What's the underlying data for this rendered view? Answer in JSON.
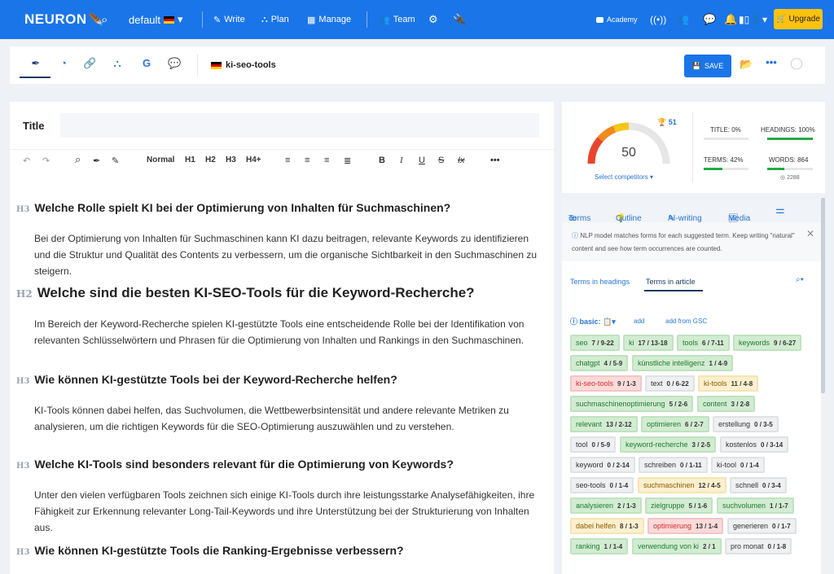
{
  "nav": {
    "logo": "NEURON",
    "project": "default",
    "write": "Write",
    "plan": "Plan",
    "manage": "Manage",
    "team": "Team",
    "academy": "Academy",
    "upgrade": "Upgrade"
  },
  "toolbar": {
    "doc_name": "ki-seo-tools",
    "save": "SAVE"
  },
  "editor": {
    "title_label": "Title",
    "title_value": "",
    "format": {
      "style": "Normal",
      "h1": "H1",
      "h2": "H2",
      "h3": "H3",
      "h4": "H4+",
      "bold": "B",
      "italic": "I",
      "underline": "U",
      "strike": "S",
      "clear": "Ix",
      "more": "•••"
    },
    "blocks": [
      {
        "level": "H3",
        "text": "Welche Rolle spielt KI bei der Optimierung von Inhalten für Suchmaschinen?"
      },
      {
        "text": "Bei der Optimierung von Inhalten für Suchmaschinen kann KI dazu beitragen, relevante Keywords zu identifizieren und die Struktur und Qualität des Contents zu verbessern, um die organische Sichtbarkeit in den Suchmaschinen zu steigern."
      },
      {
        "level": "H2",
        "text": "Welche sind die besten KI-SEO-Tools für die Keyword-Recherche?"
      },
      {
        "text": "Im Bereich der Keyword-Recherche spielen KI-gestützte Tools eine entscheidende Rolle bei der Identifikation von relevanten Schlüsselwörtern und Phrasen für die Optimierung von Inhalten und Rankings in den Suchmaschinen."
      },
      {
        "level": "H3",
        "text": "Wie können KI-gestützte Tools bei der Keyword-Recherche helfen?"
      },
      {
        "text": "KI-Tools können dabei helfen, das Suchvolumen, die Wettbewerbsintensität und andere relevante Metriken zu analysieren, um die richtigen Keywords für die SEO-Optimierung auszuwählen und zu verstehen."
      },
      {
        "level": "H3",
        "text": "Welche KI-Tools sind besonders relevant für die Optimierung von Keywords?"
      },
      {
        "text": "Unter den vielen verfügbaren Tools zeichnen sich einige KI-Tools durch ihre leistungsstarke Analysefähigkeiten, ihre Fähigkeit zur Erkennung relevanter Long-Tail-Keywords und ihre Unterstützung bei der Strukturierung von Inhalten aus."
      },
      {
        "level": "H3",
        "text": "Wie können KI-gestützte Tools die Ranking-Ergebnisse verbessern?"
      }
    ]
  },
  "score": {
    "value": "50",
    "value_fraction": 0.5,
    "competitor_score": "51",
    "select_competitors": "Select competitors ▾",
    "title_stat": "TITLE: 0%",
    "title_fraction": 0,
    "headings_stat": "HEADINGS: 100%",
    "headings_fraction": 1.0,
    "terms_stat": "TERMS: 42%",
    "terms_fraction": 0.42,
    "words_stat": "WORDS: 864",
    "words_fraction": 0.38,
    "words_target": "2288"
  },
  "side": {
    "tabs": [
      "Terms",
      "Outline",
      "AI-writing",
      "Media"
    ],
    "info": "NLP model matches forms for each suggested term. Keep writing \"natural\" content and see how term occurrences are counted.",
    "subtabs": [
      "Terms in headings",
      "Terms in article"
    ],
    "basic": "basic:",
    "add": "add",
    "add_gsc": "add from GSC",
    "terms": [
      {
        "t": "seo",
        "c": "7",
        "r": "9-22",
        "s": "g"
      },
      {
        "t": "ki",
        "c": "17",
        "r": "13-18",
        "s": "g"
      },
      {
        "t": "tools",
        "c": "6",
        "r": "7-11",
        "s": "g"
      },
      {
        "t": "keywords",
        "c": "9",
        "r": "6-27",
        "s": "g"
      },
      {
        "t": "chatgpt",
        "c": "4",
        "r": "5-9",
        "s": "g"
      },
      {
        "t": "künstliche intelligenz",
        "c": "1",
        "r": "4-9",
        "s": "g"
      },
      {
        "t": "ki-seo-tools",
        "c": "9",
        "r": "1-3",
        "s": "r"
      },
      {
        "t": "text",
        "c": "0",
        "r": "6-22",
        "s": "n"
      },
      {
        "t": "ki-tools",
        "c": "11",
        "r": "4-8",
        "s": "y"
      },
      {
        "t": "suchmaschinenoptimierung",
        "c": "5",
        "r": "2-6",
        "s": "g"
      },
      {
        "t": "content",
        "c": "3",
        "r": "2-8",
        "s": "g"
      },
      {
        "t": "relevant",
        "c": "13",
        "r": "2-12",
        "s": "g"
      },
      {
        "t": "optimieren",
        "c": "6",
        "r": "2-7",
        "s": "g"
      },
      {
        "t": "erstellung",
        "c": "0",
        "r": "3-5",
        "s": "n"
      },
      {
        "t": "tool",
        "c": "0",
        "r": "5-9",
        "s": "n"
      },
      {
        "t": "keyword-recherche",
        "c": "3",
        "r": "2-5",
        "s": "g"
      },
      {
        "t": "kostenlos",
        "c": "0",
        "r": "3-14",
        "s": "n"
      },
      {
        "t": "keyword",
        "c": "0",
        "r": "2-14",
        "s": "n"
      },
      {
        "t": "schreiben",
        "c": "0",
        "r": "1-11",
        "s": "n"
      },
      {
        "t": "ki-tool",
        "c": "0",
        "r": "1-4",
        "s": "n"
      },
      {
        "t": "seo-tools",
        "c": "0",
        "r": "1-4",
        "s": "n"
      },
      {
        "t": "suchmaschinen",
        "c": "12",
        "r": "4-5",
        "s": "y"
      },
      {
        "t": "schnell",
        "c": "0",
        "r": "3-4",
        "s": "n"
      },
      {
        "t": "analysieren",
        "c": "2",
        "r": "1-3",
        "s": "g"
      },
      {
        "t": "zielgruppe",
        "c": "5",
        "r": "1-6",
        "s": "g"
      },
      {
        "t": "suchvolumen",
        "c": "1",
        "r": "1-7",
        "s": "g"
      },
      {
        "t": "dabei helfen",
        "c": "8",
        "r": "1-3",
        "s": "y"
      },
      {
        "t": "optimierung",
        "c": "13",
        "r": "1-4",
        "s": "r"
      },
      {
        "t": "generieren",
        "c": "0",
        "r": "1-7",
        "s": "n"
      },
      {
        "t": "ranking",
        "c": "1",
        "r": "1-4",
        "s": "g"
      },
      {
        "t": "verwendung von ki",
        "c": "2",
        "r": "1",
        "s": "g"
      },
      {
        "t": "pro monat",
        "c": "0",
        "r": "1-8",
        "s": "n"
      }
    ]
  }
}
